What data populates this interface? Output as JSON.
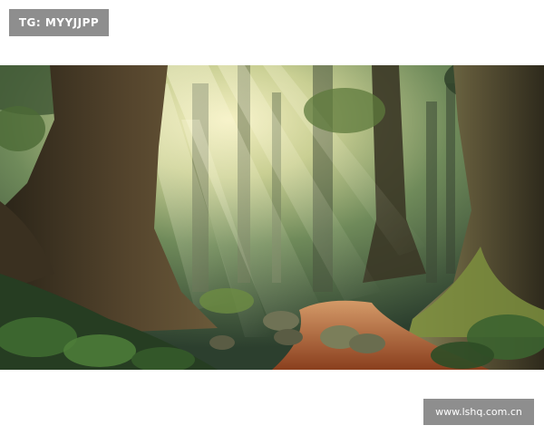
{
  "top_badge": {
    "text": "TG: MYYJJPP"
  },
  "bottom_badge": {
    "text": "www.lshq.com.cn"
  },
  "scene": {
    "subject": "forest-path-sunbeams",
    "colors": {
      "sky_light": "#e9e6b4",
      "canopy": "#3f5a37",
      "trunk": "#4a3a27",
      "moss": "#7c8f3e",
      "path": "#a4592c",
      "foreground": "#263d22"
    }
  }
}
